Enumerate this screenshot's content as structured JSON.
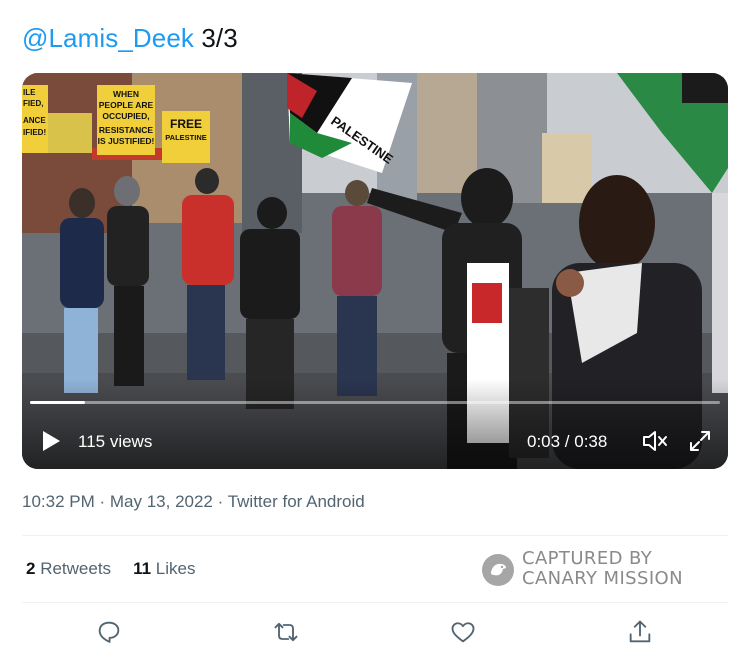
{
  "tweet": {
    "handle": "@Lamis_Deek",
    "text": " 3/3"
  },
  "video": {
    "views": "115 views",
    "time": "0:03 / 0:38",
    "progress": 0.08,
    "signs": {
      "sign1": [
        "WHEN",
        "PEOPLE ARE",
        "OCCUPIED,",
        "RESISTANCE",
        "IS JUSTIFIED!"
      ],
      "sign2": [
        "FREE",
        "PALESTINE"
      ],
      "left_edge": [
        "ILE",
        "FIED,",
        "ANCE",
        "IFIED!"
      ],
      "flag": "PALESTINE"
    },
    "icons": {
      "play": "play-icon",
      "mute": "volume-muted-icon",
      "fullscreen": "fullscreen-icon"
    }
  },
  "meta": {
    "time": "10:32 PM",
    "sep1": " · ",
    "date": "May 13, 2022",
    "sep2": " · ",
    "source": "Twitter for Android"
  },
  "stats": {
    "retweets_count": "2",
    "retweets_label": " Retweets",
    "likes_count": "11",
    "likes_label": " Likes"
  },
  "watermark": {
    "line1": "CAPTURED BY",
    "line2": "CANARY MISSION"
  },
  "actions": [
    "reply-icon",
    "retweet-icon",
    "like-icon",
    "share-icon"
  ],
  "colors": {
    "accent": "#1d9bf0",
    "text": "#0f1419",
    "muted": "#536471",
    "divider": "#eff3f4"
  }
}
